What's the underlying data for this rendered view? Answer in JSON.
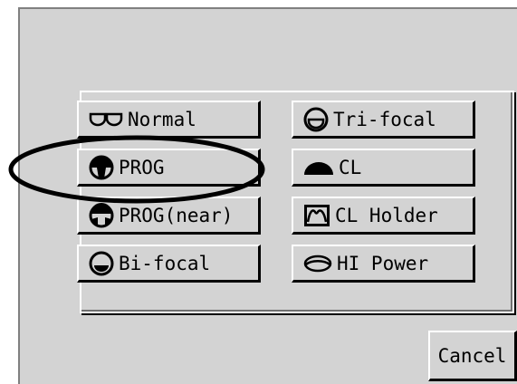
{
  "buttons_left": [
    {
      "label": "Normal",
      "icon": "normal-lens-icon"
    },
    {
      "label": "PROG",
      "icon": "prog-lens-icon"
    },
    {
      "label": "PROG(near)",
      "icon": "prog-near-lens-icon"
    },
    {
      "label": "Bi-focal",
      "icon": "bifocal-lens-icon"
    }
  ],
  "buttons_right": [
    {
      "label": "Tri-focal",
      "icon": "trifocal-lens-icon"
    },
    {
      "label": "CL",
      "icon": "contact-lens-icon"
    },
    {
      "label": "CL Holder",
      "icon": "cl-holder-icon"
    },
    {
      "label": "HI Power",
      "icon": "hi-power-lens-icon"
    }
  ],
  "cancel_label": "Cancel",
  "colors": {
    "background": "#d3d3d3",
    "highlight": "#ffffff",
    "shadow": "#000000",
    "annotation": "#000000"
  }
}
